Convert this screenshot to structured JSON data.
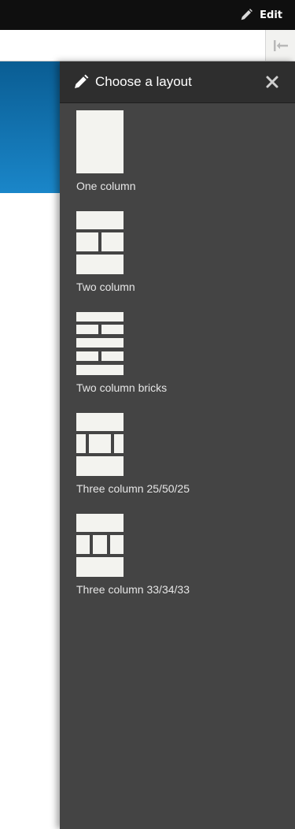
{
  "toolbar": {
    "edit_label": "Edit",
    "edit_icon": "pencil-icon",
    "collapse_icon": "collapse-tray-icon"
  },
  "tray": {
    "title": "Choose a layout",
    "title_icon": "pencil-icon",
    "close_icon": "close-icon",
    "layouts": [
      {
        "label": "One column",
        "icon": "layout-one-column-icon"
      },
      {
        "label": "Two column",
        "icon": "layout-two-column-icon"
      },
      {
        "label": "Two column bricks",
        "icon": "layout-two-column-bricks-icon"
      },
      {
        "label": "Three column 25/50/25",
        "icon": "layout-three-column-25-50-25-icon"
      },
      {
        "label": "Three column 33/34/33",
        "icon": "layout-three-column-33-34-33-icon"
      }
    ]
  },
  "colors": {
    "toolbar_bg": "#0f0f0f",
    "tray_bg": "#444444",
    "tray_header_bg": "#2e2e2e",
    "thumb_fill": "#f3f3ef",
    "hero_top": "#0a5d93",
    "hero_bottom": "#1a86c9"
  }
}
